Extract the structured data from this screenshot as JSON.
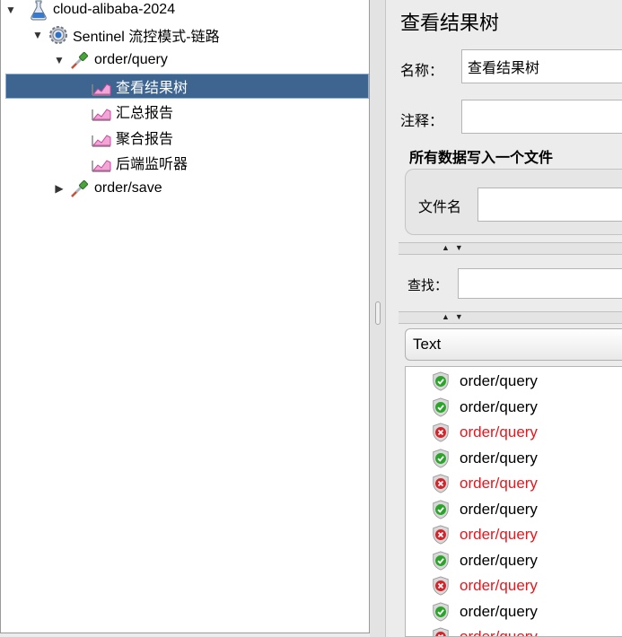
{
  "tree": {
    "items": [
      {
        "label": "cloud-alibaba-2024"
      },
      {
        "label": "Sentinel 流控模式-链路"
      },
      {
        "label": "order/query"
      },
      {
        "label": "查看结果树"
      },
      {
        "label": "汇总报告"
      },
      {
        "label": "聚合报告"
      },
      {
        "label": "后端监听器"
      },
      {
        "label": "order/save"
      }
    ],
    "selected_index": 3
  },
  "panel": {
    "title": "查看结果树",
    "name_label": "名称：",
    "name_value": "查看结果树",
    "comment_label": "注释：",
    "comment_value": "",
    "group_title": "所有数据写入一个文件",
    "filename_label": "文件名",
    "filename_value": "",
    "search_label": "查找：",
    "search_value": "",
    "renderer_selected": "Text"
  },
  "results": [
    {
      "label": "order/query",
      "status": "success"
    },
    {
      "label": "order/query",
      "status": "success"
    },
    {
      "label": "order/query",
      "status": "failure"
    },
    {
      "label": "order/query",
      "status": "success"
    },
    {
      "label": "order/query",
      "status": "failure"
    },
    {
      "label": "order/query",
      "status": "success"
    },
    {
      "label": "order/query",
      "status": "failure"
    },
    {
      "label": "order/query",
      "status": "success"
    },
    {
      "label": "order/query",
      "status": "failure"
    },
    {
      "label": "order/query",
      "status": "success"
    },
    {
      "label": "order/query",
      "status": "failure"
    }
  ],
  "colors": {
    "selection": "#3d6590",
    "success": "#2aa52a",
    "failure": "#d4232a",
    "failure_text": "#e8161c"
  }
}
